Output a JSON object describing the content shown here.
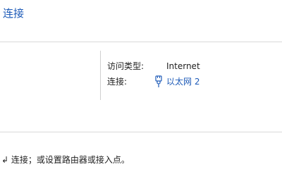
{
  "section": {
    "title": "连接"
  },
  "details": {
    "access_type_label": "访问类型:",
    "access_type_value": "Internet",
    "connection_label": "连接:",
    "connection_value": "以太网 2",
    "connection_icon": "ethernet-plug-icon"
  },
  "footer": {
    "text": "↲ 连接；或设置路由器或接入点。"
  },
  "colors": {
    "accent": "#1e5bb8",
    "text": "#1e1e1e",
    "divider": "#d9d9d9"
  }
}
